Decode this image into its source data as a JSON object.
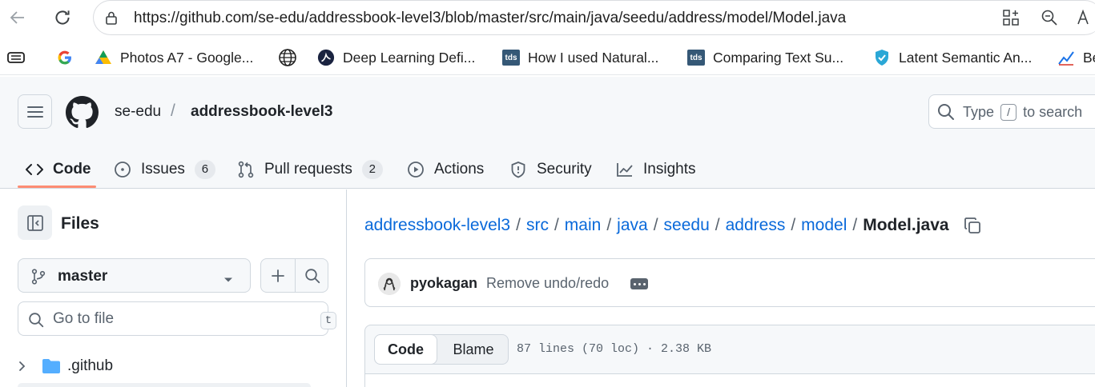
{
  "browser": {
    "url": "https://github.com/se-edu/addressbook-level3/blob/master/src/main/java/seedu/address/model/Model.java",
    "bookmarks": [
      {
        "label": "Photos A7 - Google...",
        "icon": "google-photos-icon"
      },
      {
        "label": "Deep Learning Defi...",
        "icon": "deep-learning-icon"
      },
      {
        "label": "How I used Natural...",
        "icon": "tds-icon"
      },
      {
        "label": "Comparing Text Su...",
        "icon": "tds-icon"
      },
      {
        "label": "Latent Semantic An...",
        "icon": "shield-icon"
      },
      {
        "label": "Be",
        "icon": "chart-icon"
      }
    ],
    "tds_badge": "tds"
  },
  "header": {
    "owner": "se-edu",
    "separator": "/",
    "repo": "addressbook-level3",
    "search_prefix": "Type",
    "search_key": "/",
    "search_suffix": "to search"
  },
  "tabs": [
    {
      "label": "Code",
      "count": null
    },
    {
      "label": "Issues",
      "count": "6"
    },
    {
      "label": "Pull requests",
      "count": "2"
    },
    {
      "label": "Actions",
      "count": null
    },
    {
      "label": "Security",
      "count": null
    },
    {
      "label": "Insights",
      "count": null
    }
  ],
  "sidebar": {
    "title": "Files",
    "branch": "master",
    "goto_placeholder": "Go to file",
    "goto_shortcut": "t",
    "tree": [
      {
        "name": ".github",
        "type": "folder"
      }
    ]
  },
  "breadcrumb": {
    "parts": [
      "addressbook-level3",
      "src",
      "main",
      "java",
      "seedu",
      "address",
      "model"
    ],
    "current": "Model.java",
    "sep": "/"
  },
  "commit": {
    "author": "pyokagan",
    "message": "Remove undo/redo"
  },
  "file": {
    "view_code": "Code",
    "view_blame": "Blame",
    "meta": "87 lines (70 loc) · 2.38 KB"
  },
  "colors": {
    "link": "#0969da",
    "tab_underline": "#fd8c73",
    "folder": "#54aeff"
  }
}
